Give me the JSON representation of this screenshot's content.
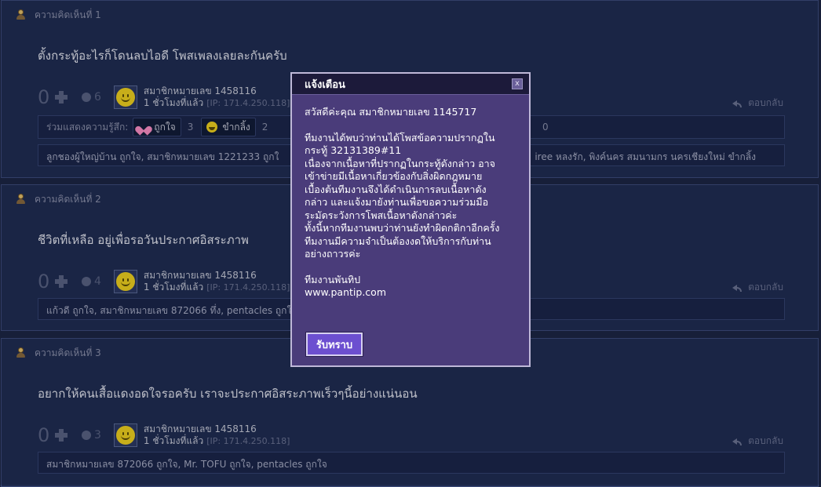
{
  "comments": [
    {
      "number_label": "ความคิดเห็นที่ 1",
      "title": "ตั้งกระทู้อะไรก็โดนลบไอดี โพสเพลงเลยละกันครับ",
      "votes": "0",
      "emotion_count": "6",
      "user_name": "สมาชิกหมายเลข 1458116",
      "time": "1 ชั่วโมงที่แล้ว",
      "ip": "[IP: 171.4.250.118]",
      "reply_label": "ตอบกลับ",
      "emotion_bar": {
        "label": "ร่วมแสดงความรู้สึก:",
        "items": [
          {
            "label": "ถูกใจ",
            "count": "3"
          },
          {
            "label": "ขำกลิ้ง",
            "count": "2"
          }
        ],
        "right_count": "0"
      },
      "likers": "ลูกชองผู้ใหญ่บ้าน ถูกใจ, สมาชิกหมายเลข 1221233 ถูกใ",
      "likers_right": "iree หลงรัก, พิงค์นคร สมนามกร นครเชียงใหม่ ขำกลิ้ง"
    },
    {
      "number_label": "ความคิดเห็นที่ 2",
      "title": "ชีวิตที่เหลือ อยู่เพื่อรอวันประกาศอิสระภาพ",
      "votes": "0",
      "emotion_count": "4",
      "user_name": "สมาชิกหมายเลข 1458116",
      "time": "1 ชั่วโมงที่แล้ว",
      "ip": "[IP: 171.4.250.118]",
      "reply_label": "ตอบกลับ",
      "likers": "แก้วดี ถูกใจ, สมาชิกหมายเลข 872066 ทึ่ง, pentacles ถูกใ"
    },
    {
      "number_label": "ความคิดเห็นที่ 3",
      "title": "อยากให้คนเสื้อแดงอดใจรอครับ เราจะประกาศอิสระภาพเร็วๆนี้อย่างแน่นอน",
      "votes": "0",
      "emotion_count": "3",
      "user_name": "สมาชิกหมายเลข 1458116",
      "time": "1 ชั่วโมงที่แล้ว",
      "ip": "[IP: 171.4.250.118]",
      "reply_label": "ตอบกลับ",
      "likers": "สมาชิกหมายเลข 872066 ถูกใจ, Mr. TOFU ถูกใจ, pentacles ถูกใจ"
    }
  ],
  "dialog": {
    "title": "แจ้งเตือน",
    "close_label": "x",
    "greeting": "สวัสดีค่ะคุณ สมาชิกหมายเลข 1145717",
    "message_lines": [
      "ทีมงานได้พบว่าท่านได้โพสข้อความปรากฏใน",
      "กระทู้ 32131389#11",
      "เนื่องจากเนื้อหาที่ปรากฏในกระทู้ดังกล่าว อาจ",
      "เข้าข่ายมีเนื้อหาเกี่ยวข้องกับสิ่งผิดกฎหมาย",
      "เบื้องต้นทีมงานจึงได้ดำเนินการลบเนื้อหาดัง",
      "กล่าว และแจ้งมายังท่านเพื่อขอความร่วมมือ",
      "ระมัดระวังการโพสเนื้อหาดังกล่าวค่ะ",
      "ทั้งนี้หากทีมงานพบว่าท่านยังทำผิดกติกาอีกครั้ง",
      "ทีมงานมีความจำเป็นต้องงดให้บริการกับท่าน",
      "อย่างถาวรค่ะ"
    ],
    "signature": "ทีมงานพันทิป",
    "site": "www.pantip.com",
    "ok_label": "รับทราบ"
  }
}
